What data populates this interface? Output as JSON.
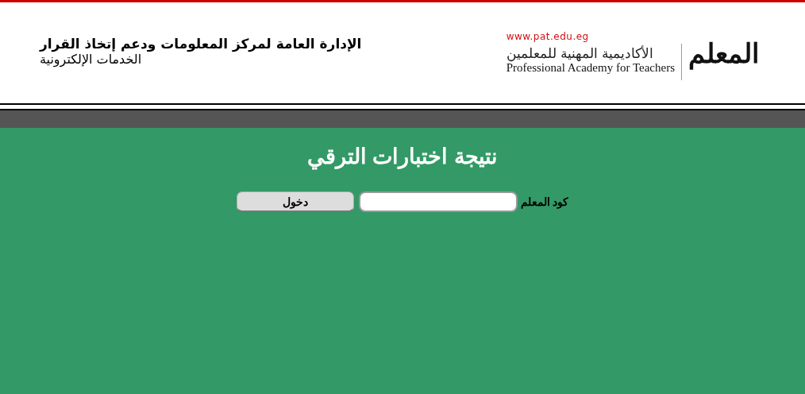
{
  "header": {
    "department": "الإدارة العامة لمركز المعلومات ودعم إتخاذ القرار",
    "subtitle": "الخدمات الإلكترونية",
    "logo": {
      "website": "www.pat.edu.eg",
      "name_ar": "الأكاديمية المهنية للمعلمين",
      "name_en": "Professional Academy for Teachers",
      "mark": "المعلم"
    }
  },
  "page": {
    "title": "نتيجة اختبارات الترقي",
    "form": {
      "label": "كود المعلم",
      "button": "دخول"
    }
  }
}
